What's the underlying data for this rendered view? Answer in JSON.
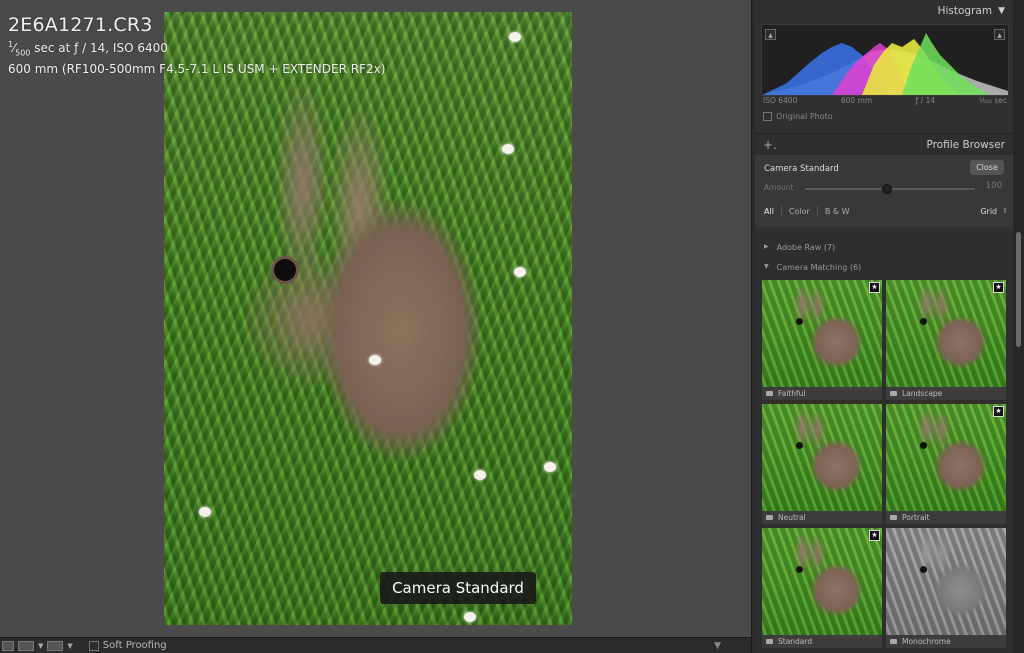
{
  "photo_info": {
    "filename": "2E6A1271.CR3",
    "shutter_numerator": "1",
    "shutter_denominator": "500",
    "exposure_rest": " sec at ƒ / 14, ISO 6400",
    "lens": "600 mm (RF100-500mm F4.5-7.1 L IS USM + EXTENDER RF2x)"
  },
  "tooltip": "Camera Standard",
  "toolbar": {
    "soft_proofing": "Soft Proofing"
  },
  "histogram": {
    "title": "Histogram",
    "iso": "ISO 6400",
    "focal": "600 mm",
    "aperture": "ƒ / 14",
    "shutter": "¹⁄₅₀₀ sec",
    "original_photo": "Original Photo",
    "colors": {
      "blue": "#3a6fe0",
      "magenta": "#e040d0",
      "yellow": "#e8e640",
      "green": "#6ee05a",
      "gray": "#b9b9b9"
    }
  },
  "profile_browser": {
    "title": "Profile Browser",
    "selected_profile": "Camera Standard",
    "close_label": "Close",
    "amount_label": "Amount",
    "amount_value": "100",
    "amount_fraction": 0.5,
    "filters": [
      "All",
      "Color",
      "B & W"
    ],
    "active_filter": "All",
    "view_mode": "Grid",
    "groups": [
      {
        "name": "Adobe Raw (7)",
        "expanded": false
      },
      {
        "name": "Camera Matching (6)",
        "expanded": true
      }
    ],
    "profiles": [
      {
        "name": "Faithful",
        "favorite": true
      },
      {
        "name": "Landscape",
        "favorite": true
      },
      {
        "name": "Neutral",
        "favorite": false
      },
      {
        "name": "Portrait",
        "favorite": true
      },
      {
        "name": "Standard",
        "favorite": true
      },
      {
        "name": "Monochrome",
        "favorite": false
      }
    ]
  },
  "icons": {
    "dropdown": "triangle-down-icon",
    "add": "plus-icon",
    "camera": "camera-icon",
    "favorite": "star-icon",
    "expand": "triangle-right-icon"
  }
}
